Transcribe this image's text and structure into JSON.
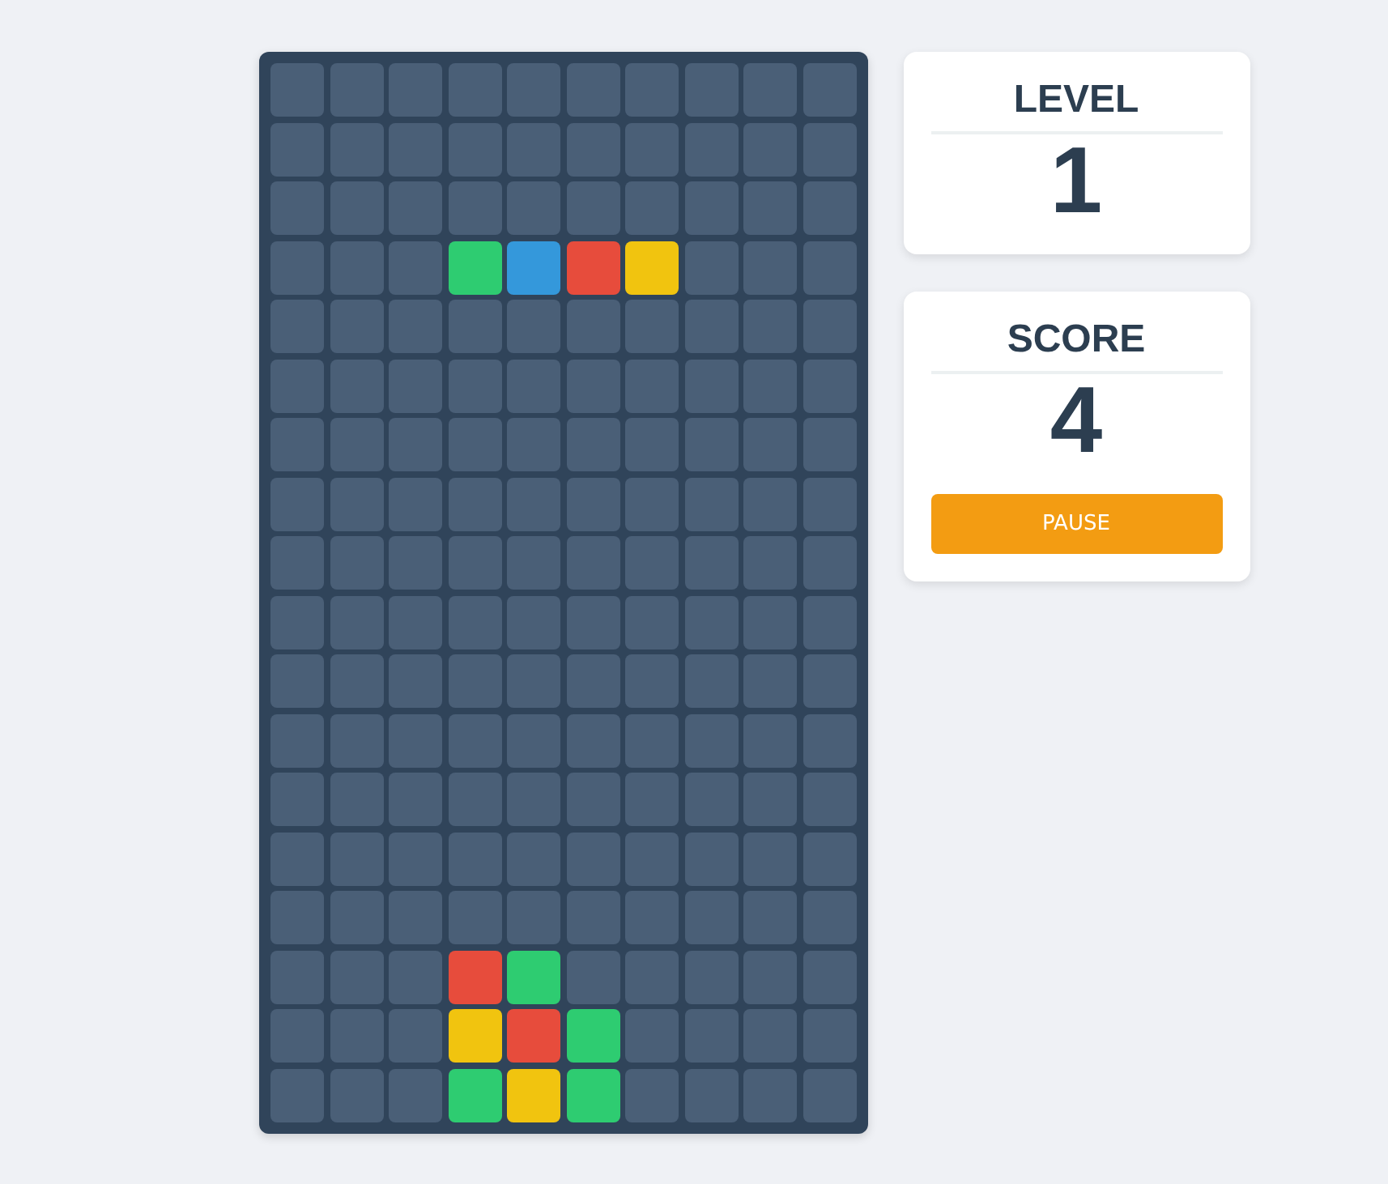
{
  "board": {
    "rows": [
      [
        {
          "filled": false
        },
        {
          "filled": false
        },
        {
          "filled": false
        },
        {
          "filled": false
        },
        {
          "filled": false
        },
        {
          "filled": false
        },
        {
          "filled": false
        },
        {
          "filled": false
        },
        {
          "filled": false
        },
        {
          "filled": false
        }
      ],
      [
        {
          "filled": false
        },
        {
          "filled": false
        },
        {
          "filled": false
        },
        {
          "filled": false
        },
        {
          "filled": false
        },
        {
          "filled": false
        },
        {
          "filled": false
        },
        {
          "filled": false
        },
        {
          "filled": false
        },
        {
          "filled": false
        }
      ],
      [
        {
          "filled": false
        },
        {
          "filled": false
        },
        {
          "filled": false
        },
        {
          "filled": false
        },
        {
          "filled": false
        },
        {
          "filled": false
        },
        {
          "filled": false
        },
        {
          "filled": false
        },
        {
          "filled": false
        },
        {
          "filled": false
        }
      ],
      [
        {
          "filled": false
        },
        {
          "filled": false
        },
        {
          "filled": false
        },
        {
          "filled": true,
          "color": "#2ecc71"
        },
        {
          "filled": true,
          "color": "#3498db"
        },
        {
          "filled": true,
          "color": "#e74c3c"
        },
        {
          "filled": true,
          "color": "#f1c40f"
        },
        {
          "filled": false
        },
        {
          "filled": false
        },
        {
          "filled": false
        }
      ],
      [
        {
          "filled": false
        },
        {
          "filled": false
        },
        {
          "filled": false
        },
        {
          "filled": false
        },
        {
          "filled": false
        },
        {
          "filled": false
        },
        {
          "filled": false
        },
        {
          "filled": false
        },
        {
          "filled": false
        },
        {
          "filled": false
        }
      ],
      [
        {
          "filled": false
        },
        {
          "filled": false
        },
        {
          "filled": false
        },
        {
          "filled": false
        },
        {
          "filled": false
        },
        {
          "filled": false
        },
        {
          "filled": false
        },
        {
          "filled": false
        },
        {
          "filled": false
        },
        {
          "filled": false
        }
      ],
      [
        {
          "filled": false
        },
        {
          "filled": false
        },
        {
          "filled": false
        },
        {
          "filled": false
        },
        {
          "filled": false
        },
        {
          "filled": false
        },
        {
          "filled": false
        },
        {
          "filled": false
        },
        {
          "filled": false
        },
        {
          "filled": false
        }
      ],
      [
        {
          "filled": false
        },
        {
          "filled": false
        },
        {
          "filled": false
        },
        {
          "filled": false
        },
        {
          "filled": false
        },
        {
          "filled": false
        },
        {
          "filled": false
        },
        {
          "filled": false
        },
        {
          "filled": false
        },
        {
          "filled": false
        }
      ],
      [
        {
          "filled": false
        },
        {
          "filled": false
        },
        {
          "filled": false
        },
        {
          "filled": false
        },
        {
          "filled": false
        },
        {
          "filled": false
        },
        {
          "filled": false
        },
        {
          "filled": false
        },
        {
          "filled": false
        },
        {
          "filled": false
        }
      ],
      [
        {
          "filled": false
        },
        {
          "filled": false
        },
        {
          "filled": false
        },
        {
          "filled": false
        },
        {
          "filled": false
        },
        {
          "filled": false
        },
        {
          "filled": false
        },
        {
          "filled": false
        },
        {
          "filled": false
        },
        {
          "filled": false
        }
      ],
      [
        {
          "filled": false
        },
        {
          "filled": false
        },
        {
          "filled": false
        },
        {
          "filled": false
        },
        {
          "filled": false
        },
        {
          "filled": false
        },
        {
          "filled": false
        },
        {
          "filled": false
        },
        {
          "filled": false
        },
        {
          "filled": false
        }
      ],
      [
        {
          "filled": false
        },
        {
          "filled": false
        },
        {
          "filled": false
        },
        {
          "filled": false
        },
        {
          "filled": false
        },
        {
          "filled": false
        },
        {
          "filled": false
        },
        {
          "filled": false
        },
        {
          "filled": false
        },
        {
          "filled": false
        }
      ],
      [
        {
          "filled": false
        },
        {
          "filled": false
        },
        {
          "filled": false
        },
        {
          "filled": false
        },
        {
          "filled": false
        },
        {
          "filled": false
        },
        {
          "filled": false
        },
        {
          "filled": false
        },
        {
          "filled": false
        },
        {
          "filled": false
        }
      ],
      [
        {
          "filled": false
        },
        {
          "filled": false
        },
        {
          "filled": false
        },
        {
          "filled": false
        },
        {
          "filled": false
        },
        {
          "filled": false
        },
        {
          "filled": false
        },
        {
          "filled": false
        },
        {
          "filled": false
        },
        {
          "filled": false
        }
      ],
      [
        {
          "filled": false
        },
        {
          "filled": false
        },
        {
          "filled": false
        },
        {
          "filled": false
        },
        {
          "filled": false
        },
        {
          "filled": false
        },
        {
          "filled": false
        },
        {
          "filled": false
        },
        {
          "filled": false
        },
        {
          "filled": false
        }
      ],
      [
        {
          "filled": false
        },
        {
          "filled": false
        },
        {
          "filled": false
        },
        {
          "filled": true,
          "color": "#e74c3c"
        },
        {
          "filled": true,
          "color": "#2ecc71"
        },
        {
          "filled": false
        },
        {
          "filled": false
        },
        {
          "filled": false
        },
        {
          "filled": false
        },
        {
          "filled": false
        }
      ],
      [
        {
          "filled": false
        },
        {
          "filled": false
        },
        {
          "filled": false
        },
        {
          "filled": true,
          "color": "#f1c40f"
        },
        {
          "filled": true,
          "color": "#e74c3c"
        },
        {
          "filled": true,
          "color": "#2ecc71"
        },
        {
          "filled": false
        },
        {
          "filled": false
        },
        {
          "filled": false
        },
        {
          "filled": false
        }
      ],
      [
        {
          "filled": false
        },
        {
          "filled": false
        },
        {
          "filled": false
        },
        {
          "filled": true,
          "color": "#2ecc71"
        },
        {
          "filled": true,
          "color": "#f1c40f"
        },
        {
          "filled": true,
          "color": "#2ecc71"
        },
        {
          "filled": false
        },
        {
          "filled": false
        },
        {
          "filled": false
        },
        {
          "filled": false
        }
      ]
    ]
  },
  "panels": [
    {
      "label": "LEVEL",
      "value": "1"
    },
    {
      "label": "SCORE",
      "value": "4",
      "button": "PAUSE"
    }
  ]
}
